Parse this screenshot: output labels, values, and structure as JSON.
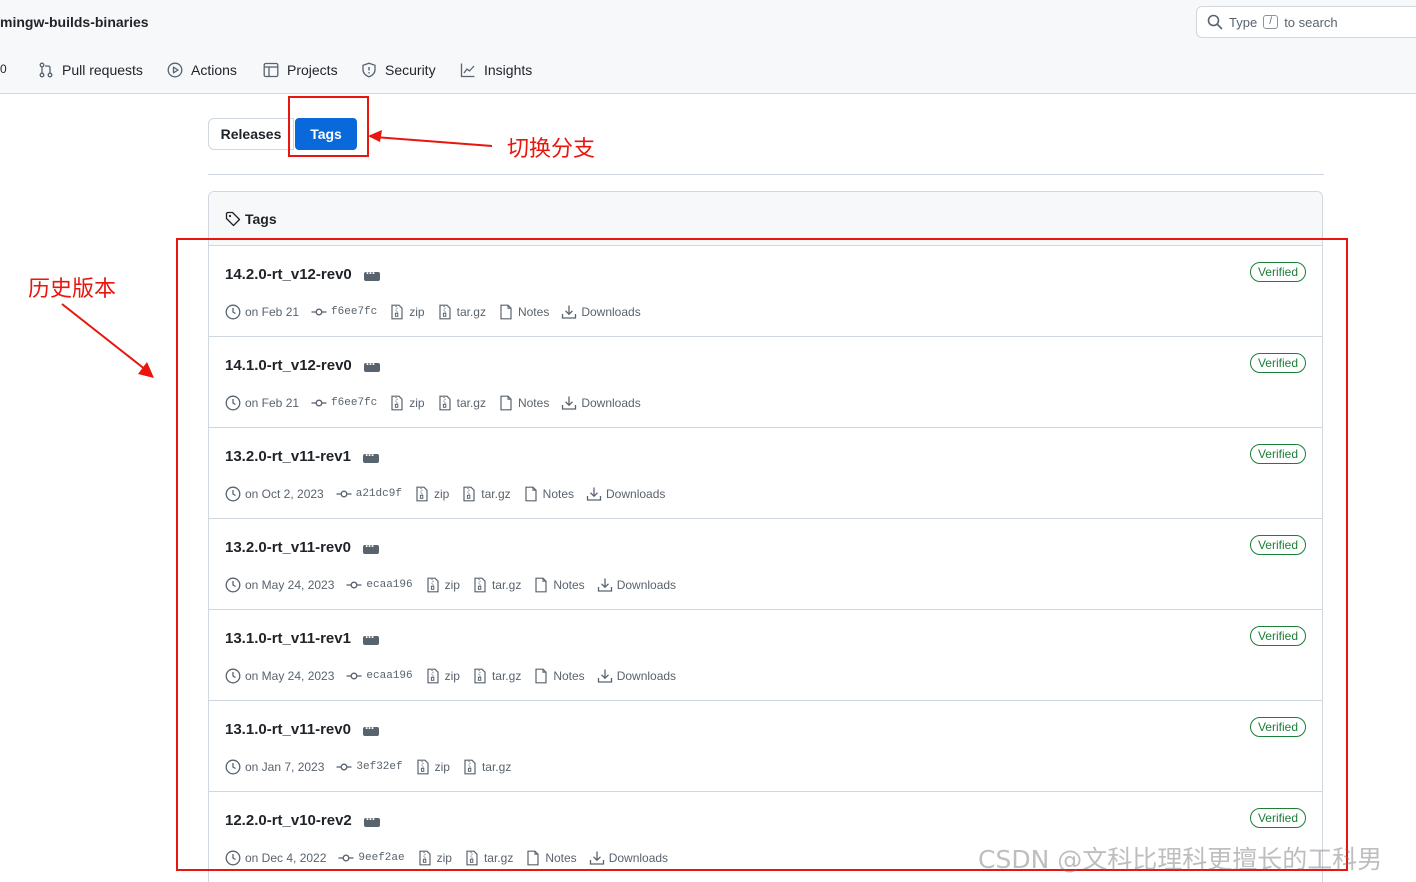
{
  "header": {
    "repo_name": "mingw-builds-binaries",
    "search_prefix": "Type",
    "search_key": "/",
    "search_suffix": "to search"
  },
  "nav": {
    "count": "0",
    "items": [
      "Pull requests",
      "Actions",
      "Projects",
      "Security",
      "Insights"
    ]
  },
  "toggle": {
    "releases": "Releases",
    "tags": "Tags"
  },
  "annotations": {
    "switch_branch": "切换分支",
    "history_versions": "历史版本"
  },
  "tags_header": "Tags",
  "tags": [
    {
      "name": "14.2.0-rt_v12-rev0",
      "date": "on Feb 21",
      "commit": "f6ee7fc",
      "zip": "zip",
      "targz": "tar.gz",
      "notes": "Notes",
      "downloads": "Downloads",
      "verified": "Verified"
    },
    {
      "name": "14.1.0-rt_v12-rev0",
      "date": "on Feb 21",
      "commit": "f6ee7fc",
      "zip": "zip",
      "targz": "tar.gz",
      "notes": "Notes",
      "downloads": "Downloads",
      "verified": "Verified"
    },
    {
      "name": "13.2.0-rt_v11-rev1",
      "date": "on Oct 2, 2023",
      "commit": "a21dc9f",
      "zip": "zip",
      "targz": "tar.gz",
      "notes": "Notes",
      "downloads": "Downloads",
      "verified": "Verified"
    },
    {
      "name": "13.2.0-rt_v11-rev0",
      "date": "on May 24, 2023",
      "commit": "ecaa196",
      "zip": "zip",
      "targz": "tar.gz",
      "notes": "Notes",
      "downloads": "Downloads",
      "verified": "Verified"
    },
    {
      "name": "13.1.0-rt_v11-rev1",
      "date": "on May 24, 2023",
      "commit": "ecaa196",
      "zip": "zip",
      "targz": "tar.gz",
      "notes": "Notes",
      "downloads": "Downloads",
      "verified": "Verified"
    },
    {
      "name": "13.1.0-rt_v11-rev0",
      "date": "on Jan 7, 2023",
      "commit": "3ef32ef",
      "zip": "zip",
      "targz": "tar.gz",
      "verified": "Verified"
    },
    {
      "name": "12.2.0-rt_v10-rev2",
      "date": "on Dec 4, 2022",
      "commit": "9eef2ae",
      "zip": "zip",
      "targz": "tar.gz",
      "notes": "Notes",
      "downloads": "Downloads",
      "verified": "Verified"
    }
  ],
  "watermark": "CSDN @文科比理科更擅长的工科男",
  "colors": {
    "accent": "#0969da",
    "annotation_red": "#e8160c",
    "verified_green": "#1a7f37"
  }
}
